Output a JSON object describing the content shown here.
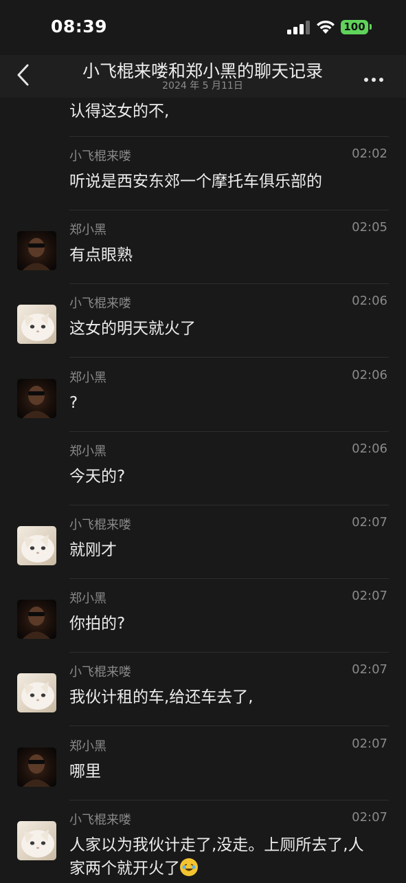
{
  "status": {
    "time": "08:39",
    "battery": "100"
  },
  "header": {
    "title": "小飞棍来喽和郑小黑的聊天记录",
    "subtitle": "2024 年 5 月11日"
  },
  "partial_message": "认得这女的不,",
  "messages": [
    {
      "sender": "小飞棍来喽",
      "time": "02:02",
      "text": "听说是西安东郊一个摩托车俱乐部的",
      "avatar": "none"
    },
    {
      "sender": "郑小黑",
      "time": "02:05",
      "text": "有点眼熟",
      "avatar": "dark-person-avatar"
    },
    {
      "sender": "小飞棍来喽",
      "time": "02:06",
      "text": "这女的明天就火了",
      "avatar": "cat-avatar"
    },
    {
      "sender": "郑小黑",
      "time": "02:06",
      "text": "?",
      "avatar": "dark-person-avatar"
    },
    {
      "sender": "郑小黑",
      "time": "02:06",
      "text": "今天的?",
      "avatar": "none"
    },
    {
      "sender": "小飞棍来喽",
      "time": "02:07",
      "text": "就刚才",
      "avatar": "cat-avatar"
    },
    {
      "sender": "郑小黑",
      "time": "02:07",
      "text": "你拍的?",
      "avatar": "dark-person-avatar"
    },
    {
      "sender": "小飞棍来喽",
      "time": "02:07",
      "text": "我伙计租的车,给还车去了,",
      "avatar": "cat-avatar"
    },
    {
      "sender": "郑小黑",
      "time": "02:07",
      "text": "哪里",
      "avatar": "dark-person-avatar"
    },
    {
      "sender": "小飞棍来喽",
      "time": "02:07",
      "text": "人家以为我伙计走了,没走。上厕所去了,人家两个就开火了",
      "avatar": "cat-avatar",
      "trailing_icon": "crying-laughing-emoji"
    }
  ]
}
